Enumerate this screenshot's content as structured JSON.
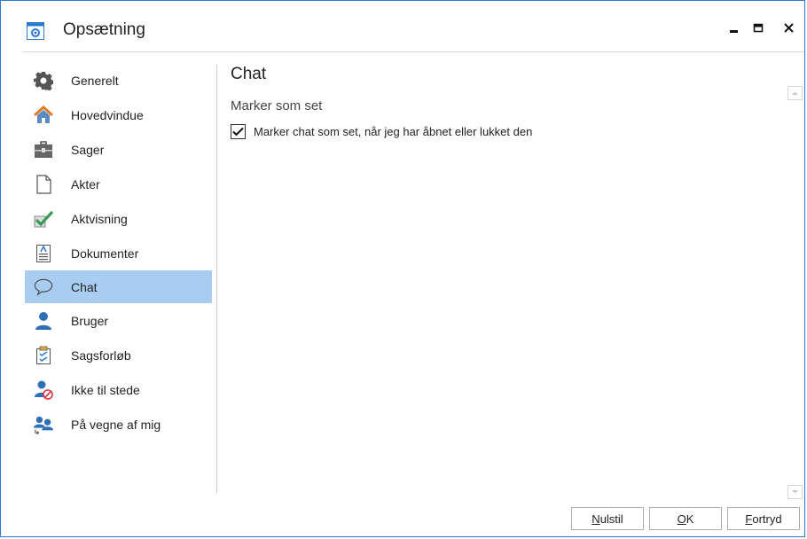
{
  "window": {
    "title": "Opsætning",
    "app_icon": "settings-window-icon",
    "controls": {
      "minimize": "minimize-icon",
      "maximize": "maximize-icon",
      "close": "close-icon"
    }
  },
  "sidebar": {
    "items": [
      {
        "label": "Generelt",
        "icon": "gear-icon"
      },
      {
        "label": "Hovedvindue",
        "icon": "house-icon"
      },
      {
        "label": "Sager",
        "icon": "briefcase-icon"
      },
      {
        "label": "Akter",
        "icon": "blank-document-icon"
      },
      {
        "label": "Aktvisning",
        "icon": "checkmark-icon"
      },
      {
        "label": "Dokumenter",
        "icon": "document-icon"
      },
      {
        "label": "Chat",
        "icon": "chat-bubble-icon",
        "selected": true
      },
      {
        "label": "Bruger",
        "icon": "user-icon"
      },
      {
        "label": "Sagsforløb",
        "icon": "clipboard-icon"
      },
      {
        "label": "Ikke til stede",
        "icon": "user-absent-icon"
      },
      {
        "label": "På vegne af mig",
        "icon": "users-delegate-icon"
      }
    ],
    "selected_color": "#a9cdf0"
  },
  "content": {
    "title": "Chat",
    "section_title": "Marker som set",
    "checkbox_label": "Marker chat som set, når jeg har åbnet eller lukket den",
    "checkbox_checked": true
  },
  "footer": {
    "reset": {
      "prefix": "",
      "underlined": "N",
      "rest": "ulstil"
    },
    "ok": {
      "prefix": "",
      "underlined": "O",
      "rest": "K"
    },
    "cancel": {
      "prefix": "",
      "underlined": "F",
      "rest": "ortryd"
    }
  },
  "colors": {
    "window_border": "#2b79d0",
    "accent": "#2b79d0"
  }
}
